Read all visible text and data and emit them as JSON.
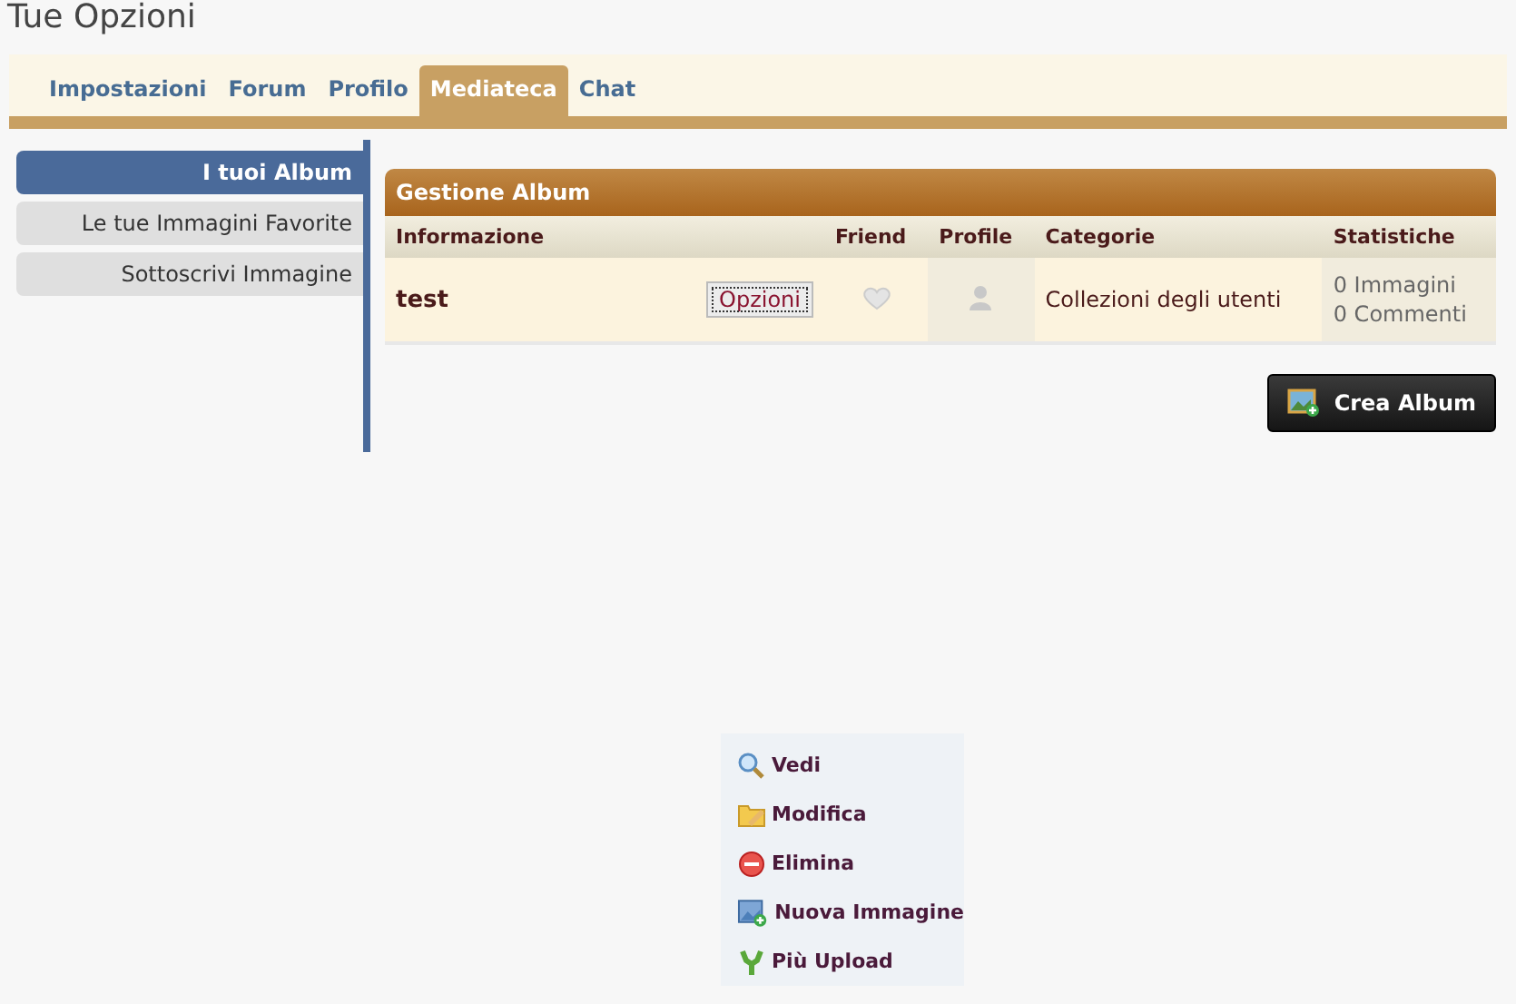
{
  "page_title": "Tue Opzioni",
  "tabs": [
    {
      "label": "Impostazioni",
      "selected": false
    },
    {
      "label": "Forum",
      "selected": false
    },
    {
      "label": "Profilo",
      "selected": false
    },
    {
      "label": "Mediateca",
      "selected": true
    },
    {
      "label": "Chat",
      "selected": false
    }
  ],
  "sidebar": {
    "items": [
      {
        "label": "I tuoi Album",
        "selected": true
      },
      {
        "label": "Le tue Immagini Favorite",
        "selected": false
      },
      {
        "label": "Sottoscrivi Immagine",
        "selected": false
      }
    ]
  },
  "album_panel": {
    "title": "Gestione Album",
    "columns": [
      "Informazione",
      "Friend",
      "Profile",
      "Categorie",
      "Statistiche"
    ],
    "rows": [
      {
        "name": "test",
        "options_button": "Opzioni",
        "category": "Collezioni degli utenti",
        "images": "0 Immagini",
        "comments": "0 Commenti"
      }
    ]
  },
  "create_button": "Crea Album",
  "context_menu": [
    {
      "kind": "view",
      "label": "Vedi"
    },
    {
      "kind": "edit",
      "label": "Modifica"
    },
    {
      "kind": "delete",
      "label": "Elimina"
    },
    {
      "kind": "new-image",
      "label": "Nuova Immagine"
    },
    {
      "kind": "upload",
      "label": "Più Upload"
    }
  ]
}
